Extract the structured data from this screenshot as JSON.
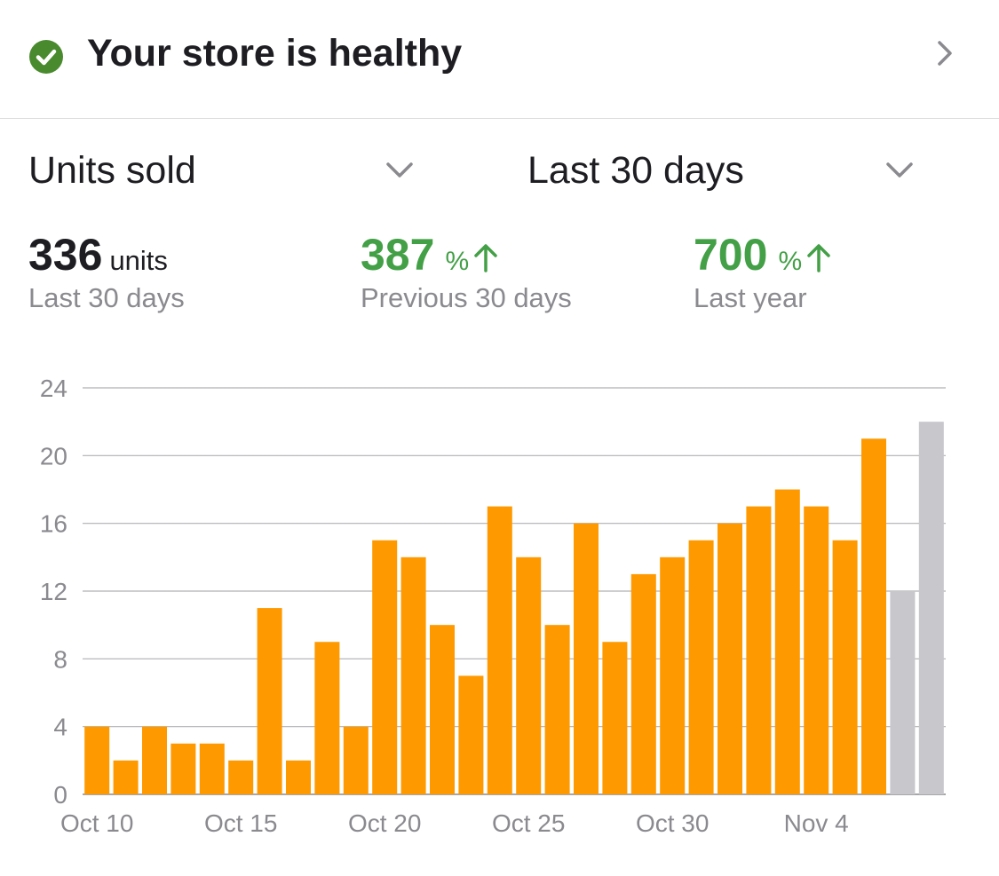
{
  "health": {
    "title": "Your store is healthy",
    "icon": "check-circle-icon",
    "status_color": "#4a8a2e"
  },
  "selectors": {
    "metric": {
      "value": "Units sold"
    },
    "range": {
      "value": "Last 30 days"
    }
  },
  "metrics": [
    {
      "value": "336",
      "unit": "units",
      "caption": "Last 30 days"
    },
    {
      "value": "387",
      "unit": "%",
      "caption": "Previous 30 days",
      "trend": "up"
    },
    {
      "value": "700",
      "unit": "%",
      "caption": "Last year",
      "trend": "up"
    }
  ],
  "colors": {
    "accent": "#ff9900",
    "projected": "#c7c7cc",
    "positive": "#43a047",
    "muted": "#8a8a8f"
  },
  "chart_data": {
    "type": "bar",
    "x": [
      "Oct 10",
      "Oct 11",
      "Oct 12",
      "Oct 13",
      "Oct 14",
      "Oct 15",
      "Oct 16",
      "Oct 17",
      "Oct 18",
      "Oct 19",
      "Oct 20",
      "Oct 21",
      "Oct 22",
      "Oct 23",
      "Oct 24",
      "Oct 25",
      "Oct 26",
      "Oct 27",
      "Oct 28",
      "Oct 29",
      "Oct 30",
      "Oct 31",
      "Nov 1",
      "Nov 2",
      "Nov 3",
      "Nov 4",
      "Nov 5",
      "Nov 6",
      "Nov 7",
      "Nov 8"
    ],
    "values": [
      4,
      2,
      4,
      3,
      3,
      2,
      11,
      2,
      9,
      4,
      15,
      14,
      10,
      7,
      17,
      14,
      10,
      16,
      9,
      13,
      14,
      15,
      16,
      17,
      18,
      17,
      15,
      21,
      12,
      22
    ],
    "highlight": [
      true,
      true,
      true,
      true,
      true,
      true,
      true,
      true,
      true,
      true,
      true,
      true,
      true,
      true,
      true,
      true,
      true,
      true,
      true,
      true,
      true,
      true,
      true,
      true,
      true,
      true,
      true,
      true,
      false,
      false
    ],
    "x_tick_labels": [
      "Oct 10",
      "Oct 15",
      "Oct 20",
      "Oct 25",
      "Oct 30",
      "Nov 4"
    ],
    "y_ticks": [
      0,
      4,
      8,
      12,
      16,
      20,
      24
    ],
    "ylim": [
      0,
      24
    ],
    "grid": true
  }
}
